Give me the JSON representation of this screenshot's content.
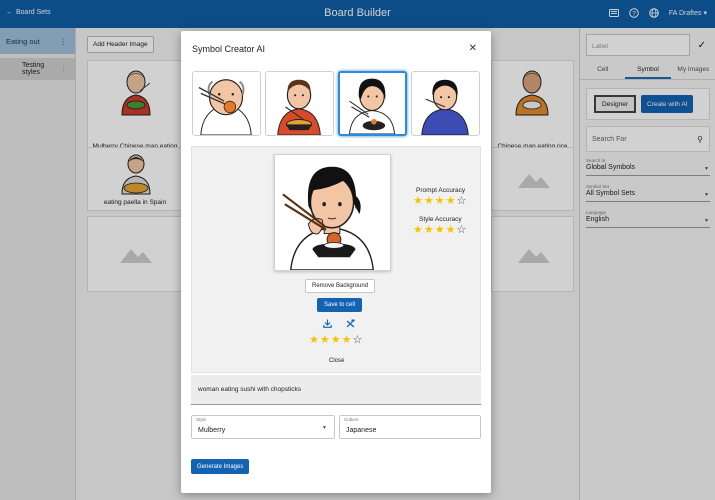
{
  "topbar": {
    "back_label": "Board Sets",
    "title": "Board Builder",
    "user": "FA Draftes"
  },
  "leftbar": {
    "board": "Eating out",
    "sub": "Testing styles"
  },
  "main": {
    "add_header": "Add Header Image",
    "cells": [
      {
        "caption": "Mulberry Chinese man eating rice with chop sticks"
      },
      {
        "caption": "eating paella in Spain"
      },
      {
        "caption": "Chinese man eating rice with chop sticks"
      }
    ]
  },
  "rightbar": {
    "label_placeholder": "Label",
    "tabs": [
      "Cell",
      "Symbol",
      "My Images"
    ],
    "designer_label": "Designer",
    "create_ai_label": "Create with AI",
    "search_placeholder": "Search For",
    "search_in_label": "Search In",
    "search_in_value": "Global Symbols",
    "symbol_set_label": "Symbol Set",
    "symbol_set_value": "All Symbol Sets",
    "language_label": "Language",
    "language_value": "English"
  },
  "modal": {
    "title": "Symbol Creator AI",
    "prompt_accuracy_label": "Prompt Accuracy",
    "prompt_accuracy_stars": 4,
    "style_accuracy_label": "Style Accuracy",
    "style_accuracy_stars": 4,
    "rating_stars": 4,
    "remove_bg_label": "Remove Background",
    "save_cell_label": "Save to cell",
    "close_label": "Close",
    "prompt_text": "woman eating sushi with chopsticks",
    "style_label": "Style",
    "style_value": "Mulberry",
    "culture_label": "Culture",
    "culture_value": "Japanese",
    "generate_label": "Generate Images"
  }
}
